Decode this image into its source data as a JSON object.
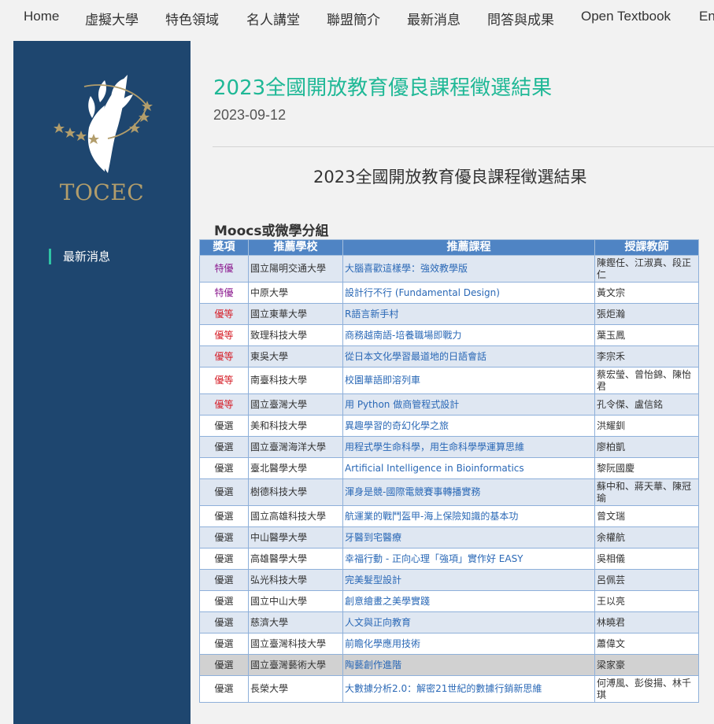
{
  "nav": {
    "items": [
      "Home",
      "虛擬大學",
      "特色領域",
      "名人講堂",
      "聯盟簡介",
      "最新消息",
      "問答與成果",
      "Open Textbook",
      "En"
    ]
  },
  "sidebar": {
    "logo_text": "TOCEC",
    "items": [
      {
        "label": "最新消息"
      }
    ]
  },
  "article": {
    "title": "2023全國開放教育優良課程徵選結果",
    "date": "2023-09-12",
    "heading": "2023全國開放教育優良課程徵選結果",
    "group_title": "Moocs或微學分組"
  },
  "table": {
    "headers": [
      "獎項",
      "推薦學校",
      "推薦課程",
      "授課教師"
    ],
    "rows": [
      {
        "award": "特優",
        "school": "國立陽明交通大學",
        "course": "大腦喜歡這樣學：強效教學版",
        "teacher": "陳鏗任、江淑真、段正仁"
      },
      {
        "award": "特優",
        "school": "中原大學",
        "course": "設計行不行 (Fundamental Design)",
        "teacher": "黃文宗"
      },
      {
        "award": "優等",
        "school": "國立東華大學",
        "course": "R語言新手村",
        "teacher": "張炬瀚"
      },
      {
        "award": "優等",
        "school": "致理科技大學",
        "course": "商務越南語-培養職場即戰力",
        "teacher": "葉玉鳳"
      },
      {
        "award": "優等",
        "school": "東吳大學",
        "course": "從日本文化學習最道地的日語會話",
        "teacher": "李宗禾"
      },
      {
        "award": "優等",
        "school": "南臺科技大學",
        "course": "校園華語即溶列車",
        "teacher": "蔡宏瑩、曾怡錦、陳怡君"
      },
      {
        "award": "優等",
        "school": "國立臺灣大學",
        "course": "用 Python 做商管程式設計",
        "teacher": "孔令傑、盧信銘"
      },
      {
        "award": "優選",
        "school": "美和科技大學",
        "course": "異趣學習的奇幻化學之旅",
        "teacher": "洪耀釧"
      },
      {
        "award": "優選",
        "school": "國立臺灣海洋大學",
        "course": "用程式學生命科學，用生命科學學運算思維",
        "teacher": "廖柏凱"
      },
      {
        "award": "優選",
        "school": "臺北醫學大學",
        "course": "Artificial Intelligence in Bioinformatics",
        "teacher": "黎阮國慶"
      },
      {
        "award": "優選",
        "school": "樹德科技大學",
        "course": "渾身是競-國際電競賽事轉播實務",
        "teacher": "蘇中和、蔣天華、陳冠瑜"
      },
      {
        "award": "優選",
        "school": "國立高雄科技大學",
        "course": "航運業的戰鬥盔甲-海上保險知識的基本功",
        "teacher": "曾文瑞"
      },
      {
        "award": "優選",
        "school": "中山醫學大學",
        "course": "牙醫到宅醫療",
        "teacher": "余權航"
      },
      {
        "award": "優選",
        "school": "高雄醫學大學",
        "course": "幸福行動 - 正向心理「強項」實作好 EASY",
        "teacher": "吳相儀"
      },
      {
        "award": "優選",
        "school": "弘光科技大學",
        "course": "完美髮型設計",
        "teacher": "呂佩芸"
      },
      {
        "award": "優選",
        "school": "國立中山大學",
        "course": "創意繪畫之美學實踐",
        "teacher": "王以亮"
      },
      {
        "award": "優選",
        "school": "慈濟大學",
        "course": "人文與正向教育",
        "teacher": "林曉君"
      },
      {
        "award": "優選",
        "school": "國立臺灣科技大學",
        "course": "前瞻化學應用技術",
        "teacher": "蕭偉文"
      },
      {
        "award": "優選",
        "school": "國立臺灣藝術大學",
        "course": "陶藝創作進階",
        "teacher": "梁家豪"
      },
      {
        "award": "優選",
        "school": "長榮大學",
        "course": "大數據分析2.0：解密21世紀的數據行銷新思維",
        "teacher": "何溥風、彭俊揚、林千琪"
      }
    ]
  },
  "colors": {
    "sidebar_bg": "#1e466f",
    "accent_teal": "#1fb896",
    "header_blue": "#4f84c4",
    "award_special": "#8b1a8f",
    "award_excellent": "#d6202a",
    "link_blue": "#2a68b6"
  }
}
